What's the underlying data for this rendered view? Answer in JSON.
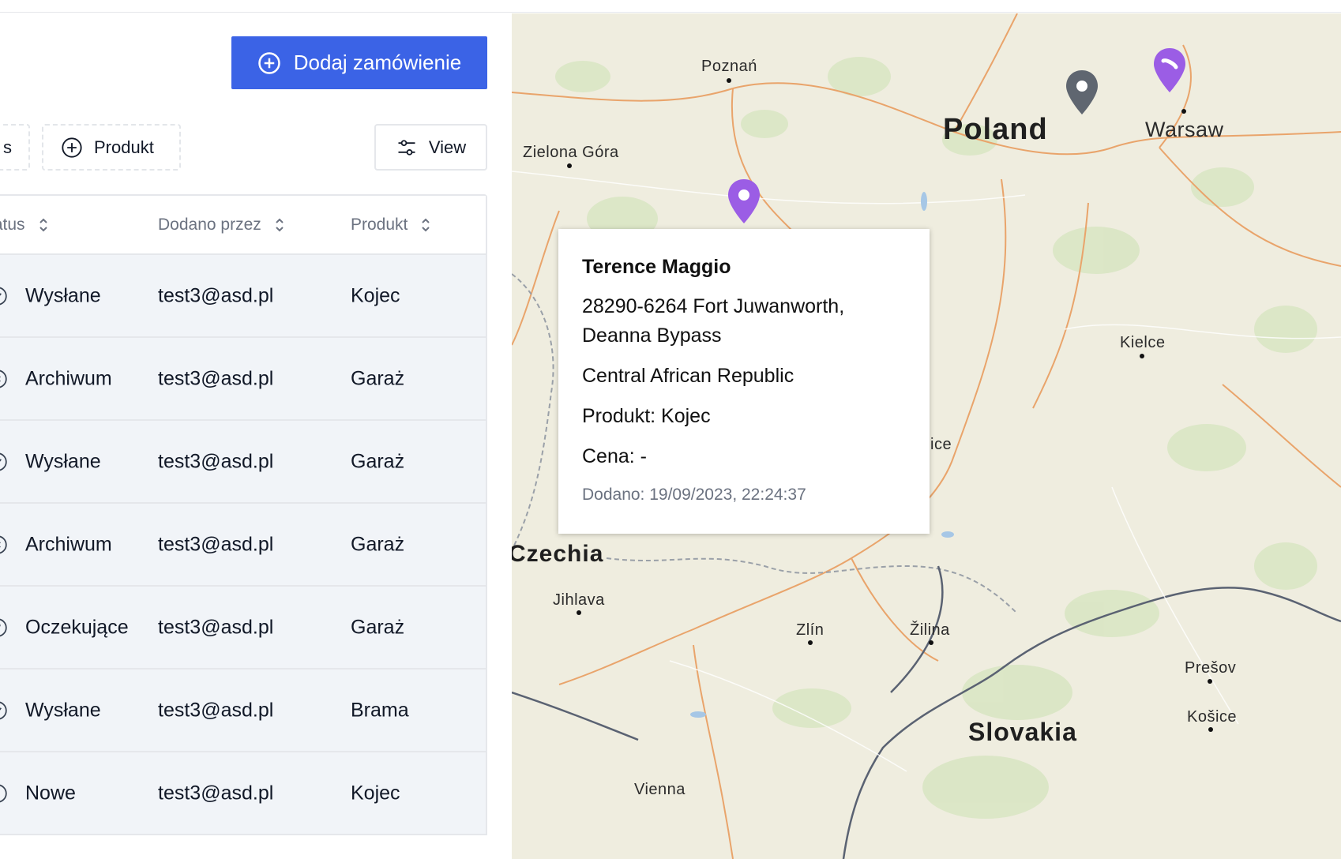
{
  "toolbar": {
    "add_order_label": "Dodaj zamówienie",
    "filter_status_fragment": "s",
    "filter_product_label": "Produkt",
    "view_label": "View"
  },
  "table": {
    "headers": {
      "status": "tatus",
      "added_by": "Dodano przez",
      "product": "Produkt"
    },
    "rows": [
      {
        "status": "Wysłane",
        "status_icon": "check-circle-icon",
        "added_by": "test3@asd.pl",
        "product": "Kojec"
      },
      {
        "status": "Archiwum",
        "status_icon": "x-circle-icon",
        "added_by": "test3@asd.pl",
        "product": "Garaż"
      },
      {
        "status": "Wysłane",
        "status_icon": "check-circle-icon",
        "added_by": "test3@asd.pl",
        "product": "Garaż"
      },
      {
        "status": "Archiwum",
        "status_icon": "x-circle-icon",
        "added_by": "test3@asd.pl",
        "product": "Garaż"
      },
      {
        "status": "Oczekujące",
        "status_icon": "question-circle-icon",
        "added_by": "test3@asd.pl",
        "product": "Garaż"
      },
      {
        "status": "Wysłane",
        "status_icon": "check-circle-icon",
        "added_by": "test3@asd.pl",
        "product": "Brama"
      },
      {
        "status": "Nowe",
        "status_icon": "circle-icon",
        "added_by": "test3@asd.pl",
        "product": "Kojec"
      }
    ]
  },
  "map": {
    "cities": {
      "poznan": "Poznań",
      "zielona_gora": "Zielona Góra",
      "warsaw": "Warsaw",
      "kielce": "Kielce",
      "jihlava": "Jihlava",
      "zlin": "Zlín",
      "zilina": "Žilina",
      "presov": "Prešov",
      "kosice": "Košice",
      "vienna": "Vienna",
      "katowice_fragment": "ice"
    },
    "countries": {
      "poland": "Poland",
      "czechia": "Czechia",
      "slovakia": "Slovakia"
    },
    "colors": {
      "pin_purple": "#9b5de5",
      "pin_gray": "#5f6670",
      "accent_blue": "#3b63e6"
    }
  },
  "popup": {
    "name": "Terence Maggio",
    "address_line1": "28290-6264 Fort Juwanworth,",
    "address_line2": "Deanna Bypass",
    "country": "Central African Republic",
    "product": "Produkt: Kojec",
    "price": "Cena: -",
    "added": "Dodano: 19/09/2023, 22:24:37"
  }
}
